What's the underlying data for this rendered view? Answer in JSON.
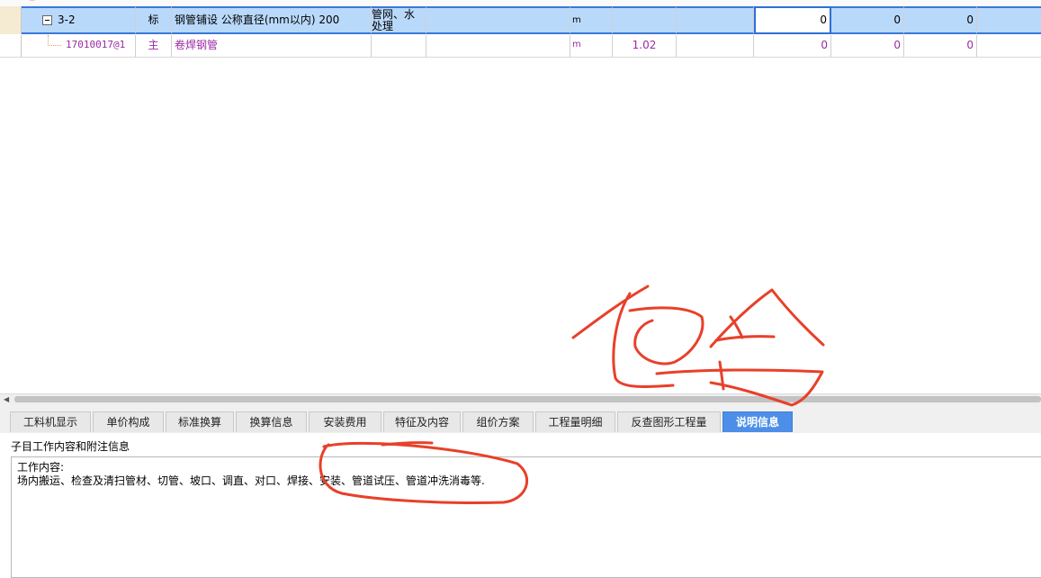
{
  "grid": {
    "selected_row": {
      "code": "3-2",
      "type": "标",
      "name": "钢管铺设 公称直径(mm以内) 200",
      "spec": "管网、水处理",
      "unit": "m",
      "qty": "",
      "val1": "0",
      "val2": "0",
      "val3": "0"
    },
    "child_row": {
      "code": "17010017@1",
      "type": "主",
      "name": "卷焊钢管",
      "spec": "",
      "unit": "m",
      "qty": "1.02",
      "val1": "0",
      "val2": "0",
      "val3": "0"
    }
  },
  "tabs": [
    {
      "label": "工料机显示",
      "active": false
    },
    {
      "label": "单价构成",
      "active": false
    },
    {
      "label": "标准换算",
      "active": false
    },
    {
      "label": "换算信息",
      "active": false
    },
    {
      "label": "安装费用",
      "active": false
    },
    {
      "label": "特征及内容",
      "active": false
    },
    {
      "label": "组价方案",
      "active": false
    },
    {
      "label": "工程量明细",
      "active": false
    },
    {
      "label": "反查图形工程量",
      "active": false
    },
    {
      "label": "说明信息",
      "active": true
    }
  ],
  "info": {
    "label": "子目工作内容和附注信息",
    "line1": "工作内容:",
    "line2": "场内搬运、检查及清扫管材、切管、坡口、调直、对口、焊接、安装、管道试压、管道冲洗消毒等."
  },
  "colors": {
    "selection": "#b9d9fb",
    "selection_border": "#3a78d8",
    "active_tab": "#4d8fe8",
    "child_text": "#9b2aa6",
    "annotation": "#e8402a"
  }
}
